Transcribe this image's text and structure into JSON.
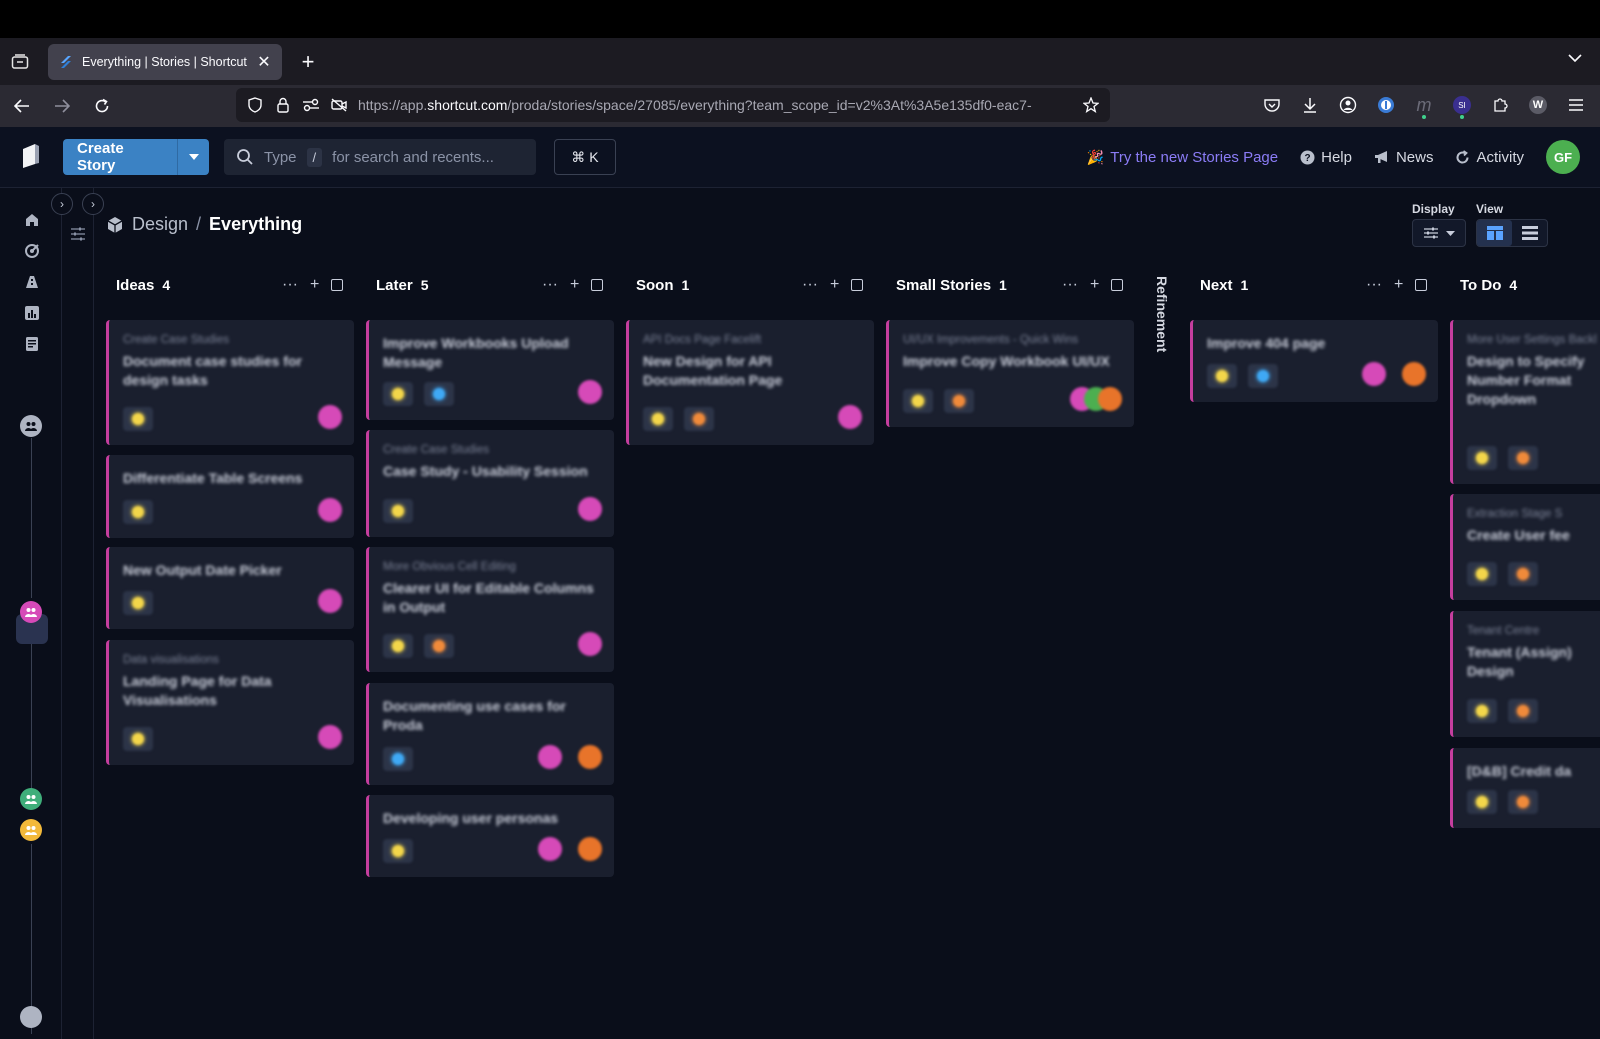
{
  "browser": {
    "tab_title": "Everything | Stories | Shortcut",
    "url_prefix": "https://app.",
    "url_domain": "shortcut.com",
    "url_rest": "/proda/stories/space/27085/everything?team_scope_id=v2%3At%3A5e135df0-eac7-"
  },
  "header": {
    "create_story": "Create Story",
    "search_type": "Type",
    "search_slash": "/",
    "search_hint": "for search and recents...",
    "cmdk": "⌘ K",
    "promo": "Try the new Stories Page",
    "help": "Help",
    "news": "News",
    "activity": "Activity",
    "avatar_initials": "GF"
  },
  "breadcrumb": {
    "space": "Design",
    "separator": "/",
    "current": "Everything"
  },
  "controls": {
    "display_label": "Display",
    "view_label": "View"
  },
  "refinement_label": "Refinement",
  "colors": {
    "accent": "#3b82c4",
    "card_stripe": "#c53e9e",
    "tag_yellow": "#f3d64a",
    "tag_orange": "#f08a3a",
    "tag_blue": "#3fa9f5",
    "owner_pink": "#d64ab8",
    "owner_orange": "#e8742a",
    "owner_green": "#4caf50"
  },
  "columns": [
    {
      "name": "Ideas",
      "count": "4",
      "cards": [
        {
          "epic": "Create Case Studies",
          "title": "Document case studies for design tasks",
          "tags": [
            "yellow"
          ],
          "owners": [
            "pink"
          ]
        },
        {
          "epic": "",
          "title": "Differentiate Table Screens",
          "tags": [
            "yellow"
          ],
          "owners": [
            "pink"
          ]
        },
        {
          "epic": "",
          "title": "New Output Date Picker",
          "tags": [
            "yellow"
          ],
          "owners": [
            "pink"
          ]
        },
        {
          "epic": "Data visualisations",
          "title": "Landing Page for Data Visualisations",
          "tags": [
            "yellow"
          ],
          "owners": [
            "pink"
          ]
        }
      ]
    },
    {
      "name": "Later",
      "count": "5",
      "cards": [
        {
          "epic": "",
          "title": "Improve Workbooks Upload Message",
          "tags": [
            "yellow",
            "blue"
          ],
          "owners": [
            "pink"
          ]
        },
        {
          "epic": "Create Case Studies",
          "title": "Case Study - Usability Session",
          "tags": [
            "yellow"
          ],
          "owners": [
            "pink"
          ]
        },
        {
          "epic": "More Obvious Cell Editing",
          "title": "Clearer UI for Editable Columns in Output",
          "tags": [
            "yellow",
            "orange"
          ],
          "owners": [
            "pink"
          ]
        },
        {
          "epic": "",
          "title": "Documenting use cases for Proda",
          "tags": [
            "blue"
          ],
          "owners": [
            "pink",
            "orange"
          ]
        },
        {
          "epic": "",
          "title": "Developing user personas",
          "tags": [
            "yellow"
          ],
          "owners": [
            "pink",
            "orange"
          ]
        }
      ]
    },
    {
      "name": "Soon",
      "count": "1",
      "cards": [
        {
          "epic": "API Docs Page Facelift",
          "title": "New Design for API Documentation Page",
          "tags": [
            "yellow",
            "orange"
          ],
          "owners": [
            "pink"
          ]
        }
      ]
    },
    {
      "name": "Small Stories",
      "count": "1",
      "cards": [
        {
          "epic": "UI/UX Improvements - Quick Wins",
          "title": "Improve Copy Workbook UI/UX",
          "tags": [
            "yellow",
            "orange"
          ],
          "owners": [
            "pink",
            "green",
            "orange"
          ]
        }
      ]
    },
    {
      "name": "Next",
      "count": "1",
      "cards": [
        {
          "epic": "",
          "title": "Improve 404 page",
          "tags": [
            "yellow",
            "blue"
          ],
          "owners": [
            "pink",
            "orange"
          ]
        }
      ]
    },
    {
      "name": "To Do",
      "count": "4",
      "cards": [
        {
          "epic": "More User Settings Backlog",
          "title": "Design to Specify Number Format Dropdown",
          "tags": [
            "yellow",
            "orange"
          ],
          "owners": []
        },
        {
          "epic": "Extraction Stage S",
          "title": "Create User fee",
          "tags": [
            "yellow",
            "orange"
          ],
          "owners": []
        },
        {
          "epic": "Tenant Centre",
          "title": "Tenant (Assign) Design",
          "tags": [
            "yellow",
            "orange"
          ],
          "owners": []
        },
        {
          "epic": "",
          "title": "[D&B] Credit da",
          "tags": [
            "yellow",
            "orange"
          ],
          "owners": []
        }
      ]
    }
  ]
}
